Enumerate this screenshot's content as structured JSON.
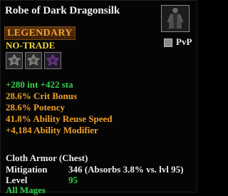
{
  "item": {
    "name": "Robe of Dark Dragonsilk",
    "rarity": "LEGENDARY",
    "flag": "NO-TRADE",
    "pvp_label": "PvP"
  },
  "stats": {
    "attributes": "+280 int +422 sta",
    "crit_bonus": "28.6% Crit Bonus",
    "potency": "28.6% Potency",
    "ability_reuse": "41.8% Ability Reuse Speed",
    "ability_modifier": "+4,184 Ability Modifier"
  },
  "armor": {
    "type": "Cloth Armor (Chest)",
    "mitigation_label": "Mitigation",
    "mitigation_value": "346 (Absorbs 3.8% vs. lvl 95)",
    "level_label": "Level",
    "level_value": "95",
    "classes": "All Mages"
  },
  "colors": {
    "rarity": "#f0a030",
    "no_trade": "#f2d43a",
    "stat_green": "#35d24a",
    "stat_orange": "#f0a12a"
  },
  "icons": {
    "adornment_slots": [
      "adornment-slot-gray-icon",
      "adornment-slot-gray-icon",
      "adornment-slot-purple-icon"
    ],
    "item": "robe-item-icon",
    "pvp_checkbox": "checkbox-icon"
  }
}
